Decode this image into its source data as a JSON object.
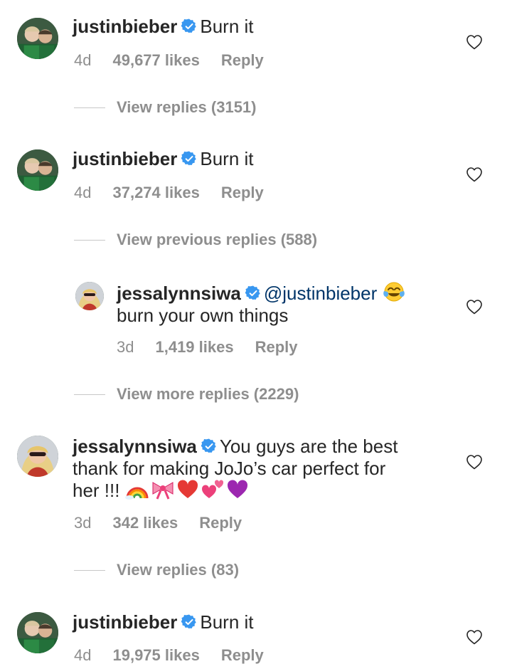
{
  "comments": [
    {
      "username": "justinbieber",
      "text": "Burn it",
      "age": "4d",
      "likes": "49,677 likes",
      "reply": "Reply",
      "view_replies": "View replies (3151)"
    },
    {
      "username": "justinbieber",
      "text": "Burn it",
      "age": "4d",
      "likes": "37,274 likes",
      "reply": "Reply",
      "view_replies": "View previous replies (588)"
    },
    {
      "username": "jessalynnsiwa",
      "mention": "@justinbieber",
      "text": "burn your own things",
      "age": "3d",
      "likes": "1,419 likes",
      "reply": "Reply",
      "view_replies": "View more replies (2229)"
    },
    {
      "username": "jessalynnsiwa",
      "text_line1": "You guys are the best",
      "text_line2": "thank for making JoJo’s car perfect for",
      "text_line3": "her !!!",
      "age": "3d",
      "likes": "342 likes",
      "reply": "Reply",
      "view_replies": "View replies (83)"
    },
    {
      "username": "justinbieber",
      "text": "Burn it",
      "age": "4d",
      "likes": "19,975 likes",
      "reply": "Reply"
    }
  ],
  "colors": {
    "text": "#262626",
    "meta": "#8e8e8e",
    "verified": "#3897f0",
    "mention": "#003569"
  },
  "icons": [
    "verified-badge-icon",
    "heart-icon",
    "avatar-image"
  ]
}
